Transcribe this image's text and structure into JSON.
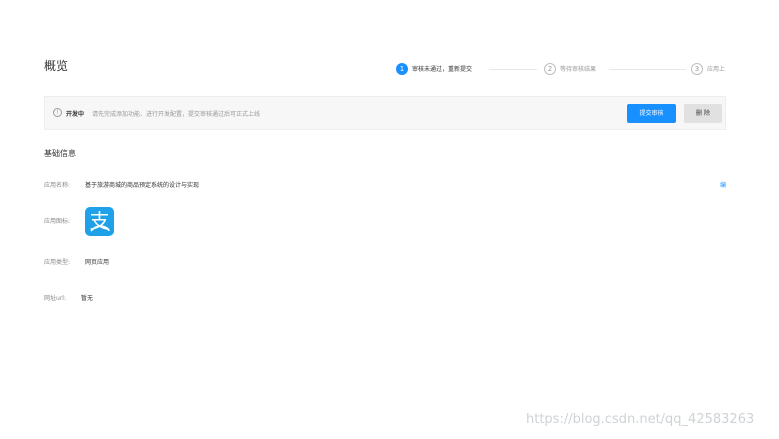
{
  "page": {
    "title": "概览"
  },
  "steps": [
    {
      "number": "1",
      "label": "审核未通过，重新提交",
      "state": "active"
    },
    {
      "number": "2",
      "label": "等待审核结果",
      "state": "inactive"
    },
    {
      "number": "3",
      "label": "应用上",
      "state": "inactive"
    }
  ],
  "status": {
    "icon": "info-icon",
    "label": "开发中",
    "description": "请先完成添加功能、进行开发配置，提交审核通过后可正式上线",
    "submit_label": "提交审核",
    "delete_label": "删 除"
  },
  "basic_info": {
    "title": "基础信息",
    "edit_label": "编",
    "fields": {
      "app_name": {
        "label": "应用名称:",
        "value": "基于旅游商城的商品预定系统的设计与实现"
      },
      "app_icon": {
        "label": "应用图标:",
        "icon": "alipay-icon",
        "icon_char": "支"
      },
      "app_type": {
        "label": "应用类型:",
        "value": "网页应用"
      },
      "url": {
        "label": "网址url:",
        "value": "暂无"
      }
    }
  },
  "colors": {
    "primary": "#1890ff",
    "icon_bg": "#1ea1e8"
  },
  "watermark": "https://blog.csdn.net/qq_42583263"
}
